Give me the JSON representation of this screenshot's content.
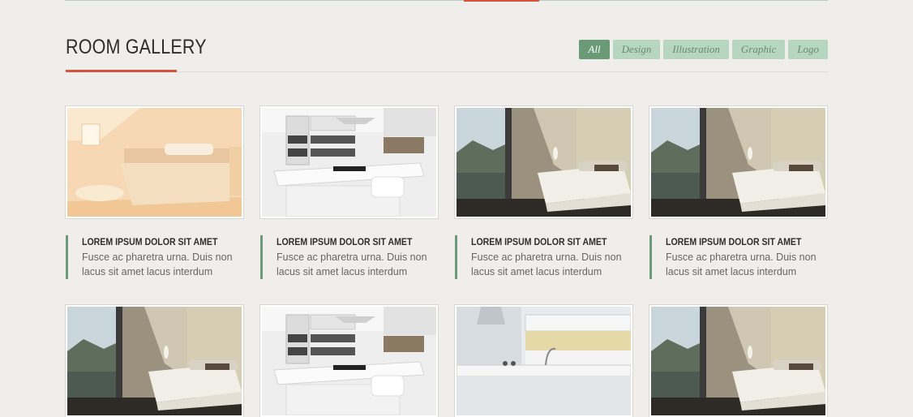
{
  "gallery": {
    "title": "ROOM GALLERY",
    "filters": [
      {
        "label": "All",
        "active": true
      },
      {
        "label": "Design",
        "active": false
      },
      {
        "label": "Illustration",
        "active": false
      },
      {
        "label": "Graphic",
        "active": false
      },
      {
        "label": "Logo",
        "active": false
      }
    ],
    "items": [
      {
        "image": "bright-bedroom",
        "title": "LOREM IPSUM DOLOR SIT AMET",
        "text": "Fusce ac pharetra urna. Duis non lacus sit amet lacus interdum"
      },
      {
        "image": "white-kitchen",
        "title": "LOREM IPSUM DOLOR SIT AMET",
        "text": "Fusce ac pharetra urna. Duis non lacus sit amet lacus interdum"
      },
      {
        "image": "bedroom-view",
        "title": "LOREM IPSUM DOLOR SIT AMET",
        "text": "Fusce ac pharetra urna. Duis non lacus sit amet lacus interdum"
      },
      {
        "image": "bedroom-view",
        "title": "LOREM IPSUM DOLOR SIT AMET",
        "text": "Fusce ac pharetra urna. Duis non lacus sit amet lacus interdum"
      },
      {
        "image": "bedroom-view"
      },
      {
        "image": "white-kitchen"
      },
      {
        "image": "modern-kitchen"
      },
      {
        "image": "bedroom-view"
      }
    ]
  },
  "colors": {
    "accent_red": "#d9533a",
    "accent_green": "#6a9b76",
    "filter_inactive": "#b7d6bf",
    "background": "#efeeea"
  }
}
